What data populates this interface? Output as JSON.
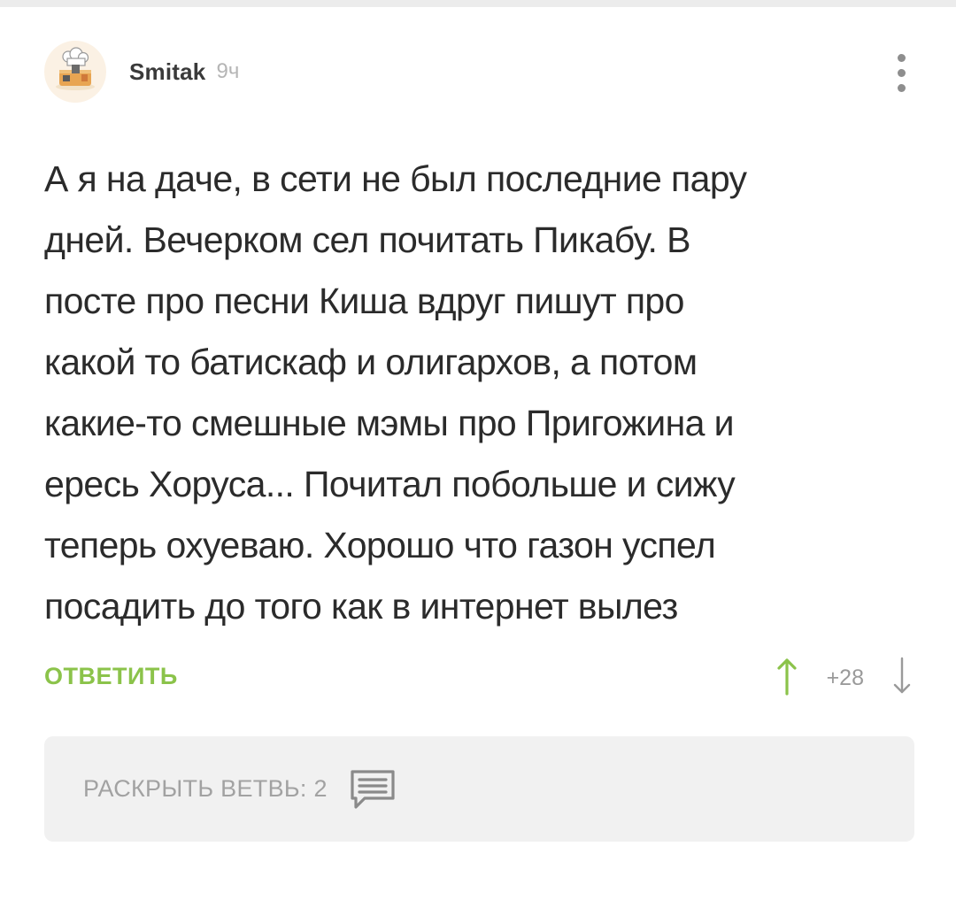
{
  "comment": {
    "author": "Smitak",
    "time": "9ч",
    "avatar_icon": "chef-avatar-icon",
    "more_icon": "more-vertical-icon",
    "body_lines": [
      "А я на даче, в сети не был последние пару",
      "дней. Вечерком сел почитать Пикабу. В",
      "посте про песни Киша вдруг пишут про",
      "какой то батискаф и олигархов, а потом",
      "какие-то смешные мэмы про Пригожина и",
      "ересь Хоруса... Почитал побольше и сижу",
      "теперь охуеваю. Хорошо что газон успел",
      "посадить до того как в интернет вылез"
    ],
    "reply_label": "ОТВЕТИТЬ",
    "rating": "+28",
    "vote_up_icon": "arrow-up-icon",
    "vote_down_icon": "arrow-down-icon",
    "branch_label": "РАСКРЫТЬ ВЕТВЬ: 2",
    "branch_icon": "comment-lines-icon"
  },
  "colors": {
    "accent_green": "#8bc34a",
    "text": "#2b2b2b",
    "muted": "#a2a2a2",
    "panel": "#f1f1f1"
  }
}
